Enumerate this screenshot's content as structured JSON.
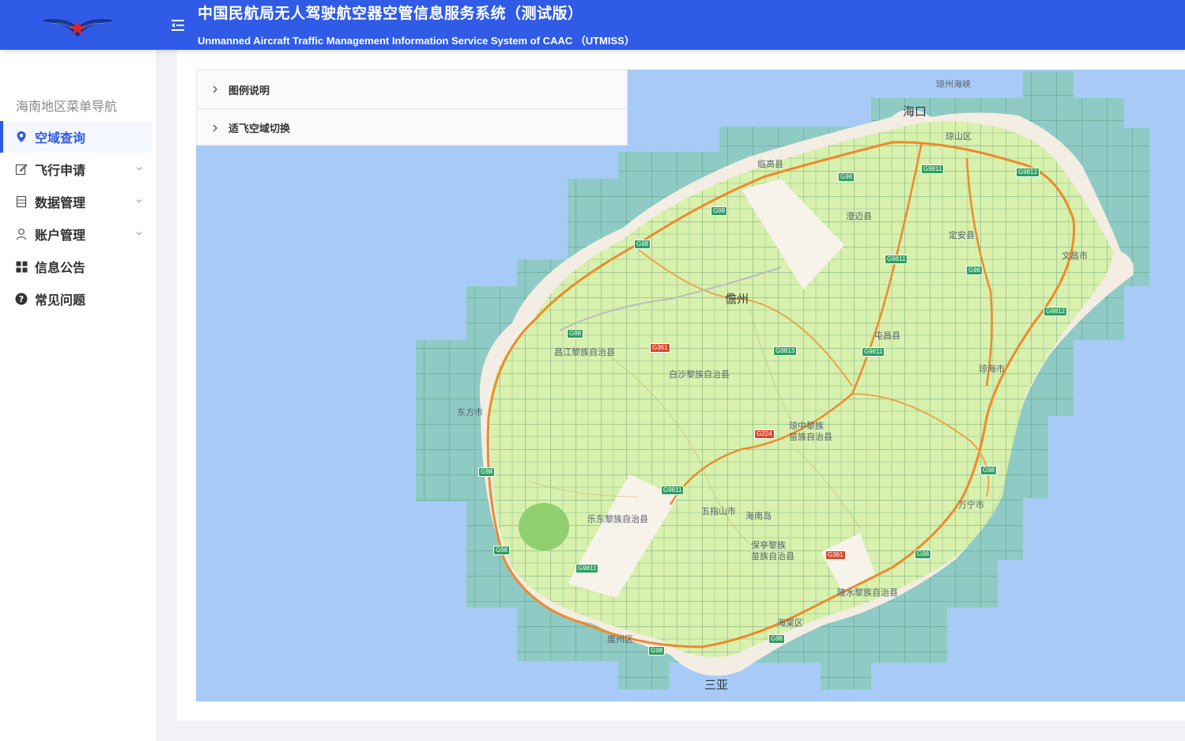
{
  "header": {
    "title_cn": "中国民航局无人驾驶航空器空管信息服务系统（测试版）",
    "title_en": "Unmanned Aircraft Traffic Management Information Service System of CAAC （UTMISS）",
    "logo_icon": "caac-wings-logo",
    "toggle_icon": "menu-fold-icon",
    "color": "#2f5be7"
  },
  "sidebar": {
    "heading": "海南地区菜单导航",
    "items": [
      {
        "label": "空域查询",
        "icon": "location-icon",
        "active": true
      },
      {
        "label": "飞行申请",
        "icon": "edit-icon",
        "has_submenu": true
      },
      {
        "label": "数据管理",
        "icon": "database-icon",
        "has_submenu": true
      },
      {
        "label": "账户管理",
        "icon": "user-icon",
        "has_submenu": true
      },
      {
        "label": "信息公告",
        "icon": "grid-icon"
      },
      {
        "label": "常见问题",
        "icon": "question-icon"
      }
    ]
  },
  "panel": {
    "rows": [
      {
        "label": "图例说明"
      },
      {
        "label": "适飞空域切换"
      }
    ]
  },
  "map": {
    "labels": {
      "haikou": "海口",
      "danzhou": "儋州",
      "sanya": "三亚",
      "qiongzhou": "琼州海峡",
      "haikou_hw": "海峡",
      "linan": "临高县",
      "chengmai": "澄迈县",
      "dingan": "定安县",
      "wenchang": "文昌市",
      "tunchang": "屯昌县",
      "qionghai": "琼海市",
      "changjiang": "昌江黎族自治县",
      "baisha": "白沙黎族自治县",
      "dongfang": "东方市",
      "qiongzhong": "琼中黎族\n苗族自治县",
      "wuzhishan": "五指山市",
      "hainandao": "海南岛",
      "ledong": "乐东黎族自治县",
      "baoting": "保亭黎族\n苗族自治县",
      "lingshui": "陵水黎族自治县",
      "wanning": "万宁市",
      "yazhou": "崖州区",
      "haitang": "海棠区",
      "qiongshan": "琼山区"
    },
    "shields": [
      "G98",
      "G9811",
      "G9812",
      "G9813",
      "G361",
      "G224",
      "G98",
      "G98",
      "G98",
      "G98",
      "G98",
      "G98",
      "G98",
      "G9811",
      "G9811",
      "G9811",
      "G9811",
      "G9812",
      "G361",
      "G98",
      "G98",
      "G98"
    ]
  }
}
